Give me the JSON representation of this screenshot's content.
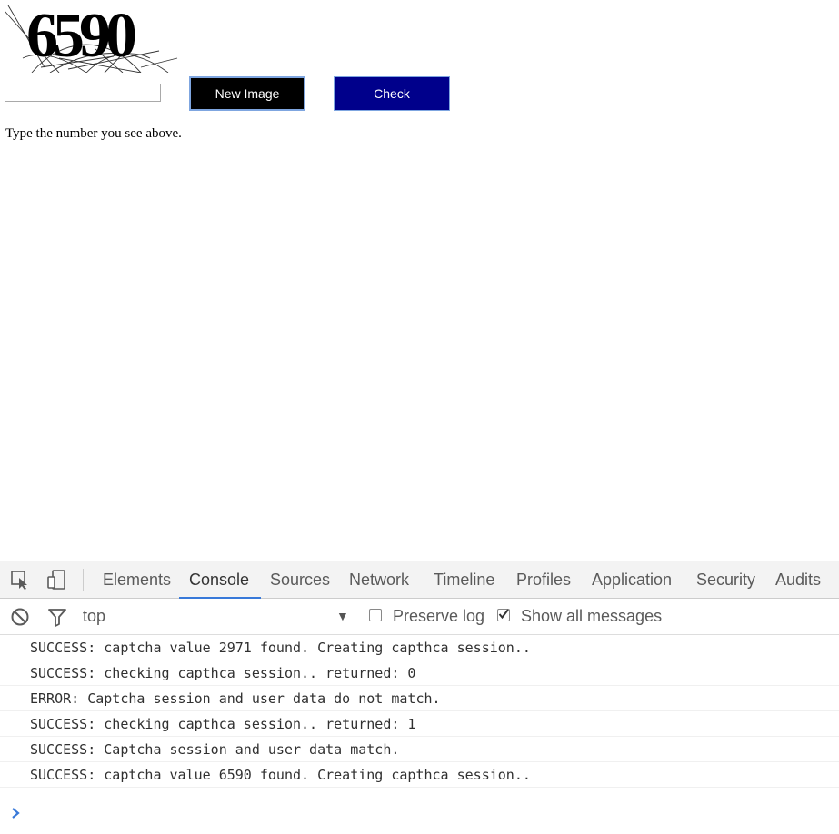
{
  "captcha": {
    "image_text": "6590",
    "input_value": "",
    "new_image_label": "New Image",
    "check_label": "Check",
    "instructions": "Type the number you see above."
  },
  "devtools": {
    "tabs": [
      {
        "label": "Elements",
        "active": false
      },
      {
        "label": "Console",
        "active": true
      },
      {
        "label": "Sources",
        "active": false
      },
      {
        "label": "Network",
        "active": false
      },
      {
        "label": "Timeline",
        "active": false
      },
      {
        "label": "Profiles",
        "active": false
      },
      {
        "label": "Application",
        "active": false
      },
      {
        "label": "Security",
        "active": false
      },
      {
        "label": "Audits",
        "active": false
      }
    ],
    "toolbar": {
      "context": "top",
      "preserve_log_label": "Preserve log",
      "preserve_log_checked": false,
      "show_all_label": "Show all messages",
      "show_all_checked": true
    },
    "console_messages": [
      "SUCCESS: captcha value 2971 found. Creating capthca session..",
      "SUCCESS: checking capthca session.. returned: 0",
      "ERROR: Captcha session and user data do not match.",
      "SUCCESS: checking capthca session.. returned: 1",
      "SUCCESS: Captcha session and user data match.",
      "SUCCESS: captcha value 6590 found. Creating capthca session.."
    ],
    "accent_color": "#3879d9"
  },
  "icons": {
    "inspect": "inspect-element-icon",
    "device": "device-toolbar-icon",
    "clear": "clear-console-icon",
    "filter": "filter-icon",
    "prompt": "console-prompt-icon"
  }
}
